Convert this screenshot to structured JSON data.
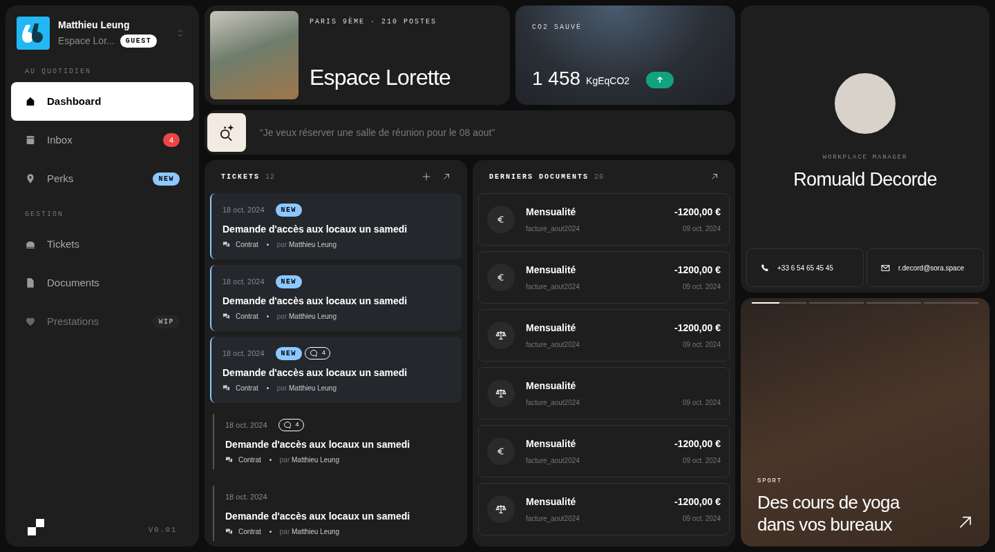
{
  "account": {
    "name": "Matthieu Leung",
    "space": "Espace Lor...",
    "role": "GUEST"
  },
  "sidebar": {
    "sections": [
      {
        "title": "AU QUOTIDIEN",
        "items": [
          {
            "kind": "home",
            "label": "Dashboard",
            "selected": true,
            "disabled": false
          },
          {
            "kind": "inbox",
            "label": "Inbox",
            "selected": false,
            "disabled": false,
            "badge": {
              "kind": "count",
              "text": "4"
            }
          },
          {
            "kind": "pin",
            "label": "Perks",
            "selected": false,
            "disabled": false,
            "badge": {
              "kind": "new",
              "text": "NEW"
            }
          }
        ]
      },
      {
        "title": "GESTION",
        "items": [
          {
            "kind": "bell",
            "label": "Tickets",
            "selected": false,
            "disabled": false
          },
          {
            "kind": "file",
            "label": "Documents",
            "selected": false,
            "disabled": false
          },
          {
            "kind": "heart",
            "label": "Prestations",
            "selected": false,
            "disabled": true,
            "badge": {
              "kind": "wip",
              "text": "WIP"
            }
          }
        ]
      }
    ],
    "version": "V0.01"
  },
  "space_card": {
    "meta": "PARIS 9ÈME · 210 POSTES",
    "title": "Espace Lorette"
  },
  "co2_card": {
    "label": "CO2 SAUVÉ",
    "value": "1 458",
    "unit": "KgEqCO2"
  },
  "assistant": {
    "placeholder": "“Je veux réserver une salle de réunion pour le 08 aout”"
  },
  "tickets": {
    "title": "TICKETS",
    "count": "12",
    "items": [
      {
        "unread": true,
        "date": "18 oct. 2024",
        "new": true,
        "new_label": "NEW",
        "title": "Demande d'accès aux locaux un samedi",
        "category": "Contrat",
        "by": "par",
        "author": "Matthieu Leung"
      },
      {
        "unread": true,
        "date": "18 oct. 2024",
        "new": true,
        "new_label": "NEW",
        "title": "Demande d'accès aux locaux un samedi",
        "category": "Contrat",
        "by": "par",
        "author": "Matthieu Leung"
      },
      {
        "unread": true,
        "date": "18 oct. 2024",
        "new": true,
        "new_label": "NEW",
        "comments": "4",
        "title": "Demande d'accès aux locaux un samedi",
        "category": "Contrat",
        "by": "par",
        "author": "Matthieu Leung"
      },
      {
        "unread": false,
        "date": "18 oct. 2024",
        "new": false,
        "comments": "4",
        "title": "Demande d'accès aux locaux un samedi",
        "category": "Contrat",
        "by": "par",
        "author": "Matthieu Leung"
      },
      {
        "unread": false,
        "date": "18 oct. 2024",
        "new": false,
        "title": "Demande d'accès aux locaux un samedi",
        "category": "Contrat",
        "by": "par",
        "author": "Matthieu Leung"
      }
    ]
  },
  "documents": {
    "title": "DERNIERS DOCUMENTS",
    "count": "20",
    "items": [
      {
        "kind": "euro",
        "title": "Mensualité",
        "file": "facture_aout2024",
        "amount": "-1200,00 €",
        "date": "09 oct. 2024"
      },
      {
        "kind": "euro",
        "title": "Mensualité",
        "file": "facture_aout2024",
        "amount": "-1200,00 €",
        "date": "09 oct. 2024"
      },
      {
        "kind": "legal",
        "title": "Mensualité",
        "file": "facture_aout2024",
        "amount": "-1200,00 €",
        "date": "09 oct. 2024"
      },
      {
        "kind": "legal",
        "title": "Mensualité",
        "file": "facture_aout2024",
        "date": "09 oct. 2024"
      },
      {
        "kind": "euro",
        "title": "Mensualité",
        "file": "facture_aout2024",
        "amount": "-1200,00 €",
        "date": "09 oct. 2024"
      },
      {
        "kind": "legal",
        "title": "Mensualité",
        "file": "facture_aout2024",
        "amount": "-1200,00 €",
        "date": "09 oct. 2024"
      }
    ]
  },
  "manager": {
    "role": "WORKPLACE MANAGER",
    "name": "Romuald Decorde",
    "phone": "+33 6 54 65 45 45",
    "email": "r.decord@sora.space"
  },
  "promo": {
    "progress": [
      {
        "level": 0.5
      },
      {
        "level": 0
      },
      {
        "level": 0
      },
      {
        "level": 0
      }
    ],
    "category": "SPORT",
    "title": "Des cours de yoga dans vos bureaux"
  }
}
